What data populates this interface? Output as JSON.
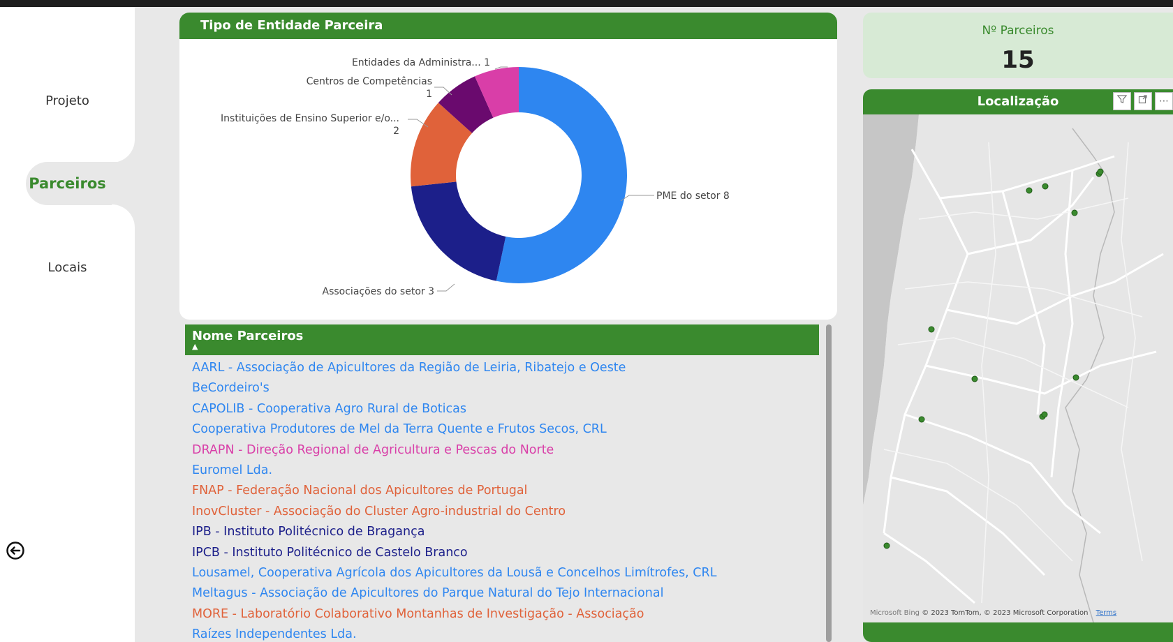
{
  "nav": {
    "items": [
      {
        "label": "Projeto",
        "active": false
      },
      {
        "label": "Parceiros",
        "active": true
      },
      {
        "label": "Locais",
        "active": false
      }
    ],
    "back_icon": "back-arrow-circle-icon"
  },
  "donut": {
    "title": "Tipo de Entidade Parceira",
    "labels": [
      {
        "text": "PME do setor 8"
      },
      {
        "text": "Associações do setor 3"
      },
      {
        "text": "Instituições de Ensino Superior e/o...",
        "value": "2"
      },
      {
        "text": "Centros de Competências",
        "value": "1"
      },
      {
        "text": "Entidades da Administra... 1"
      }
    ]
  },
  "chart_data": {
    "type": "pie",
    "title": "Tipo de Entidade Parceira",
    "categories": [
      "PME do setor",
      "Associações do setor",
      "Instituições de Ensino Superior e/o...",
      "Centros de Competências",
      "Entidades da Administra..."
    ],
    "values": [
      8,
      3,
      2,
      1,
      1
    ],
    "colors": [
      "#2e86f0",
      "#1c1f8a",
      "#e0623a",
      "#6a0a6e",
      "#d93ea8"
    ]
  },
  "partners": {
    "header": "Nome Parceiros",
    "sort_icon": "sort-ascending-icon",
    "items": [
      {
        "name": "AARL - Associação de Apicultores da Região de Leiria, Ribatejo e Oeste",
        "color": "#2e86f0"
      },
      {
        "name": "BeCordeiro's",
        "color": "#2e86f0"
      },
      {
        "name": "CAPOLIB - Cooperativa Agro Rural de Boticas",
        "color": "#2e86f0"
      },
      {
        "name": "Cooperativa Produtores de Mel da Terra Quente e Frutos Secos, CRL",
        "color": "#2e86f0"
      },
      {
        "name": "DRAPN - Direção Regional de Agricultura e Pescas do Norte",
        "color": "#d93ea8"
      },
      {
        "name": "Euromel Lda.",
        "color": "#2e86f0"
      },
      {
        "name": "FNAP - Federação Nacional dos Apicultores de Portugal",
        "color": "#e0623a"
      },
      {
        "name": "InovCluster - Associação do Cluster Agro-industrial do Centro",
        "color": "#e0623a"
      },
      {
        "name": "IPB - Instituto Politécnico de Bragança",
        "color": "#1c1f8a"
      },
      {
        "name": "IPCB - Instituto Politécnico de Castelo Branco",
        "color": "#1c1f8a"
      },
      {
        "name": "Lousamel, Cooperativa Agrícola dos Apicultores da Lousã e Concelhos Limítrofes, CRL",
        "color": "#2e86f0"
      },
      {
        "name": "Meltagus - Associação de Apicultores do Parque Natural do Tejo Internacional",
        "color": "#2e86f0"
      },
      {
        "name": "MORE - Laboratório Colaborativo Montanhas de Investigação - Associação",
        "color": "#e0623a"
      },
      {
        "name": "Raízes Independentes Lda.",
        "color": "#2e86f0"
      }
    ]
  },
  "kpi": {
    "label": "Nº Parceiros",
    "value": "15"
  },
  "map": {
    "title": "Localização",
    "tools": [
      "filter-icon",
      "focus-mode-icon",
      "more-options-icon"
    ],
    "credit_brand": "Microsoft Bing",
    "credit": "© 2023 TomTom, © 2023 Microsoft Corporation",
    "terms": "Terms",
    "marker_color": "#3a8a2e"
  }
}
